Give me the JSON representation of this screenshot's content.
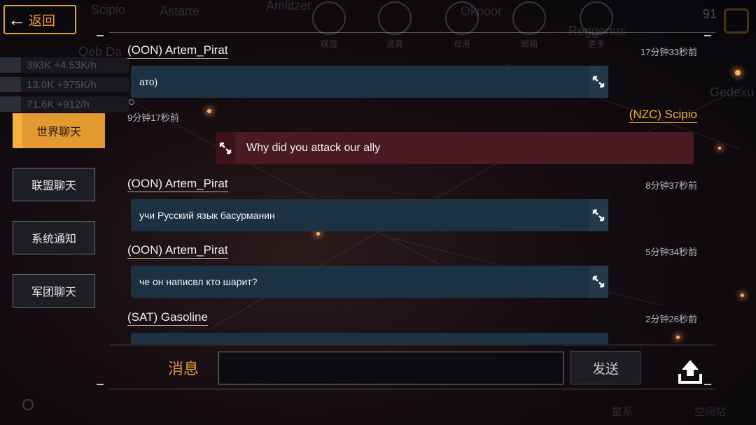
{
  "back_button": {
    "label": "返回"
  },
  "background": {
    "map_labels": [
      "Scipio",
      "Astarte",
      "Amlitzer",
      "Oknoor",
      "Reggenus",
      "Qeb Da",
      "Gedexu"
    ],
    "right_counter": "91",
    "bottom_labels": [
      "星系",
      "空间站"
    ]
  },
  "top_nav": [
    {
      "label": "联盟",
      "icon": "globe-icon"
    },
    {
      "label": "道具",
      "icon": "item-icon"
    },
    {
      "label": "母港",
      "icon": "ship-icon"
    },
    {
      "label": "邮箱",
      "icon": "mail-icon"
    },
    {
      "label": "更多",
      "icon": "plus-icon"
    }
  ],
  "resources": [
    {
      "value": "393K",
      "rate": "+4.53K/h"
    },
    {
      "value": "13.0K",
      "rate": "+975K/h"
    },
    {
      "value": "71.6K",
      "rate": "+912/h"
    }
  ],
  "tabs": [
    {
      "label": "世界聊天",
      "active": true
    },
    {
      "label": "联盟聊天",
      "active": false
    },
    {
      "label": "系统通知",
      "active": false
    },
    {
      "label": "军团聊天",
      "active": false
    }
  ],
  "messages": [
    {
      "author": "(OON) Artem_Pirat",
      "time": "17分钟33秒前",
      "text": "ато)",
      "self": false
    },
    {
      "author": "(NZC) Scipio",
      "time": "9分钟17秒前",
      "text": "Why did you attack our ally",
      "self": true
    },
    {
      "author": "(OON) Artem_Pirat",
      "time": "8分钟37秒前",
      "text": "учи Русский язык басурманин",
      "self": false
    },
    {
      "author": "(OON) Artem_Pirat",
      "time": "5分钟34秒前",
      "text": "че он написвл кто шарит?",
      "self": false
    },
    {
      "author": "(SAT) Gasoline",
      "time": "2分钟26秒前",
      "text": "",
      "self": false
    }
  ],
  "composer": {
    "label": "消息",
    "input_value": "",
    "send_label": "发送"
  },
  "colors": {
    "accent": "#e29a30",
    "bubble": "#1c3142",
    "self_bubble": "#4a1a22",
    "self_author": "#f0b030"
  }
}
